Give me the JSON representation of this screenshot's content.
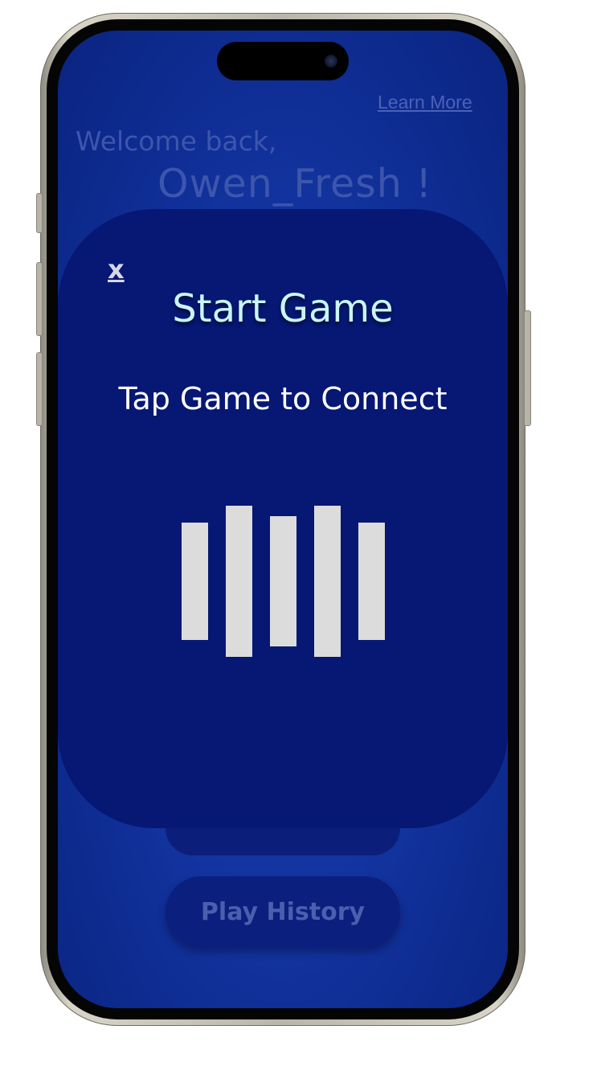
{
  "header": {
    "learn_more": "Learn More",
    "welcome": "Welcome back,",
    "username": "Owen_Fresh !"
  },
  "modal": {
    "close_label": "x",
    "title": "Start Game",
    "subtitle": "Tap Game to Connect",
    "icon": "nfc-bars-icon"
  },
  "buttons": {
    "play_history": "Play History"
  },
  "colors": {
    "screen_bg": "#1334a0",
    "modal_bg": "#061774",
    "title_color": "#c9f5f7",
    "bar_color": "#dcdcdc"
  }
}
